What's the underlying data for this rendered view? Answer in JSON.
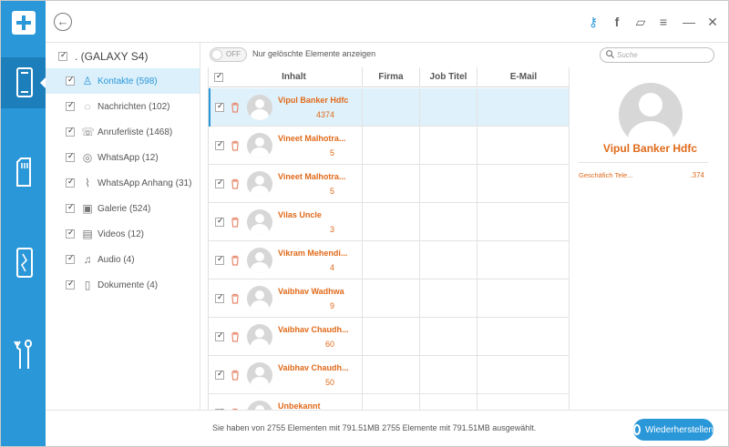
{
  "device": {
    "name": ". (GALAXY S4)"
  },
  "sidebar": {
    "items": [
      {
        "label": "Kontakte (598)",
        "icon": "contact-icon"
      },
      {
        "label": "Nachrichten (102)",
        "icon": "message-icon"
      },
      {
        "label": "Anruferliste (1468)",
        "icon": "phone-icon"
      },
      {
        "label": "WhatsApp (12)",
        "icon": "whatsapp-icon"
      },
      {
        "label": "WhatsApp Anhang (31)",
        "icon": "paperclip-icon"
      },
      {
        "label": "Galerie (524)",
        "icon": "image-icon"
      },
      {
        "label": "Videos (12)",
        "icon": "video-icon"
      },
      {
        "label": "Audio (4)",
        "icon": "music-note-icon"
      },
      {
        "label": "Dokumente (4)",
        "icon": "document-icon"
      }
    ]
  },
  "toolbar": {
    "toggle_label": "OFF",
    "filter_label": "Nur gelöschte Elemente anzeigen",
    "search_placeholder": "Suche"
  },
  "table": {
    "headers": {
      "content": "Inhalt",
      "company": "Firma",
      "job_title": "Job Titel",
      "email": "E-Mail"
    },
    "rows": [
      {
        "name": "Vipul Banker Hdfc",
        "number": "4374",
        "selected": true
      },
      {
        "name": "Vineet Malhotra...",
        "number": "5",
        "selected": false
      },
      {
        "name": "Vineet Malhotra...",
        "number": "5",
        "selected": false
      },
      {
        "name": "Vilas Uncle",
        "number": "3",
        "selected": false
      },
      {
        "name": "Vikram Mehendi...",
        "number": "4",
        "selected": false
      },
      {
        "name": "Vaibhav Wadhwa",
        "number": "9",
        "selected": false
      },
      {
        "name": "Vaibhav Chaudh...",
        "number": "60",
        "selected": false
      },
      {
        "name": "Vaibhav Chaudh...",
        "number": "50",
        "selected": false
      },
      {
        "name": "Unbekannt",
        "number": "",
        "selected": false
      }
    ]
  },
  "detail": {
    "name": "Vipul Banker Hdfc",
    "field_label": "Geschäfich Tele...",
    "field_value": ".374"
  },
  "footer": {
    "status": "Sie haben von 2755 Elementen mit 791.51MB 2755 Elemente mit 791.51MB ausgewählt.",
    "restore_label": "Wiederherstellen"
  },
  "colors": {
    "accent": "#2a97d8",
    "contact_text": "#e06a1a",
    "selection": "#dff1fb"
  }
}
